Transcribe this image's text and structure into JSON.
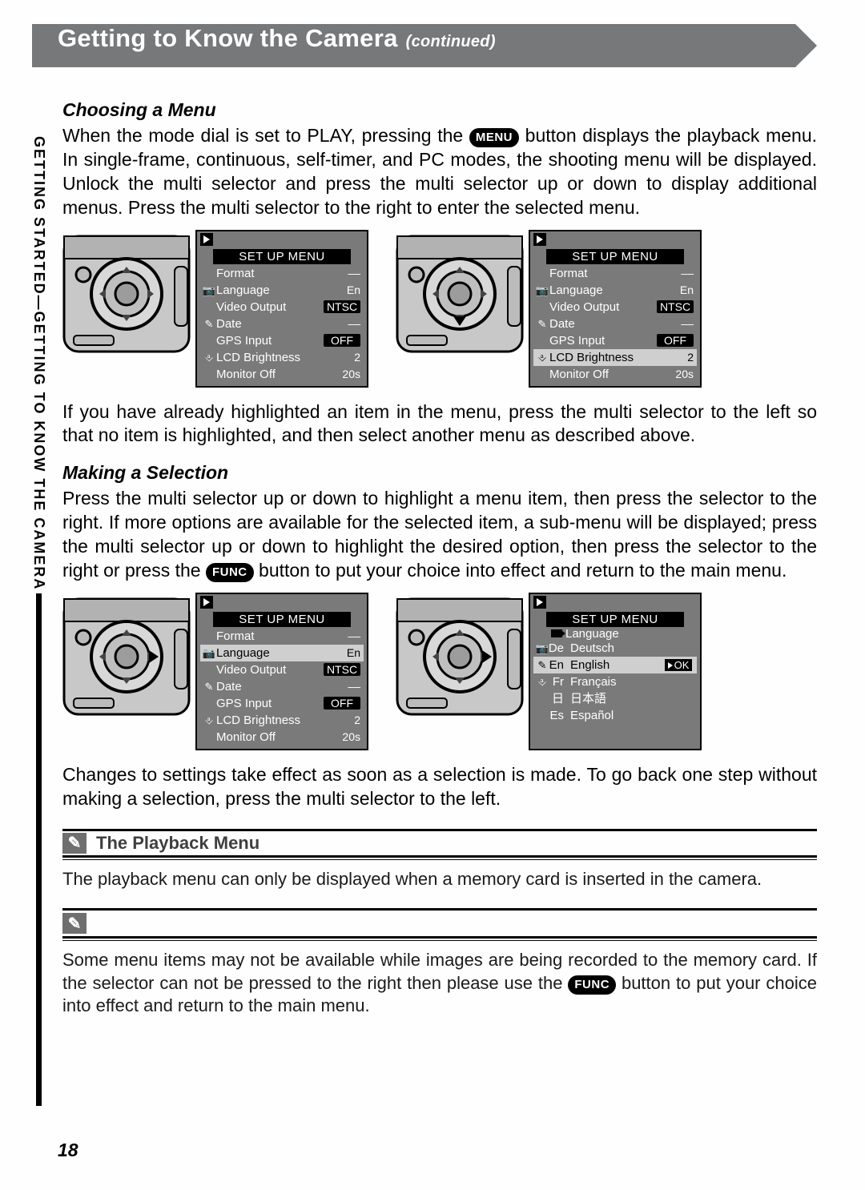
{
  "banner": {
    "title": "Getting to Know the Camera",
    "continued": "(continued)"
  },
  "sideTab": "GETTING STARTED—GETTING TO KNOW THE CAMERA",
  "sec1": {
    "heading": "Choosing a Menu",
    "p1a": "When the mode dial is set to PLAY, pressing the ",
    "menuBadge": "MENU",
    "p1b": " button displays the playback menu.  In single-frame, continuous, self-timer, and PC modes, the shooting menu will be displayed.  Unlock the multi selector and press the multi selector up or down to display additional menus.  Press the multi selector to the right to enter the selected menu.",
    "p2": "If you have already highlighted an item in the menu, press the multi selector to the left so that no item is highlighted, and then select another menu as described above."
  },
  "sec2": {
    "heading": "Making a Selection",
    "p1a": "Press the multi selector up or down to highlight a menu item, then press the selector to the right.  If more options are available for the selected item, a sub-menu will be displayed; press the multi selector up or down to highlight the desired option, then press the selector to the right or press the ",
    "funcBadge": "FUNC",
    "p1b": " button to put your choice into effect and return to the main menu.",
    "p2": "Changes to settings take effect as soon as a selection is made.  To go back one step without making a selection, press the multi selector to the left."
  },
  "lcd": {
    "title": "SET UP MENU",
    "rows": [
      {
        "label": "Format",
        "value": "––",
        "icon": ""
      },
      {
        "label": "Language",
        "value": "En",
        "icon": "📷"
      },
      {
        "label": "Video Output",
        "value": "NTSC",
        "valueBadge": true,
        "icon": ""
      },
      {
        "label": "Date",
        "value": "––",
        "icon": "✎"
      },
      {
        "label": "GPS Input",
        "value": "OFF",
        "valueBadge": true,
        "icon": ""
      },
      {
        "label": "LCD Brightness",
        "value": "2",
        "icon": "⎀"
      },
      {
        "label": "Monitor Off",
        "value": "20s",
        "icon": ""
      }
    ]
  },
  "lcdLang": {
    "title": "SET UP MENU",
    "sub": "Language",
    "ok": "OK",
    "rows": [
      {
        "code": "De",
        "label": "Deutsch"
      },
      {
        "code": "En",
        "label": "English",
        "selected": true
      },
      {
        "code": "Fr",
        "label": "Français"
      },
      {
        "code": "日",
        "label": "日本語"
      },
      {
        "code": "Es",
        "label": "Español"
      }
    ],
    "sideIcons": [
      "📷",
      "✎",
      "⎀"
    ]
  },
  "noteA": {
    "title": "The Playback Menu",
    "body": "The playback menu can only be displayed when a memory card is inserted in the camera."
  },
  "noteB": {
    "b1": "Some menu items may not be available while images are being recorded to the memory card. If the selector can not be pressed to the right then please use the ",
    "funcBadge": "FUNC",
    "b2": " button to put your choice into effect and return to the main menu."
  },
  "pageNumber": "18"
}
